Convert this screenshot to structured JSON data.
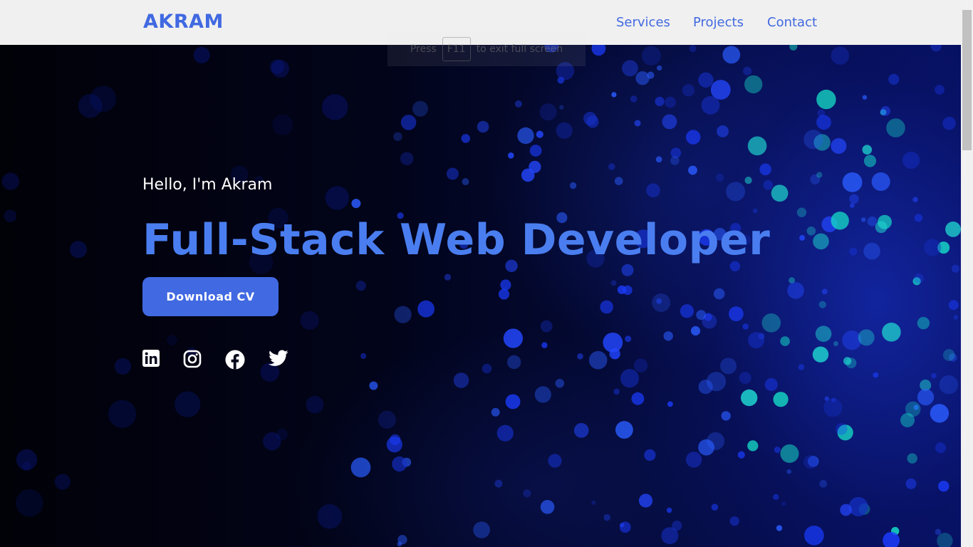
{
  "nav": {
    "logo": "AKRAM",
    "links": [
      {
        "label": "Services"
      },
      {
        "label": "Projects"
      },
      {
        "label": "Contact"
      }
    ]
  },
  "hero": {
    "greeting": "Hello, I'm Akram",
    "headline": "Full-Stack Web Developer",
    "button_label": "Download CV",
    "socials": [
      "linkedin-icon",
      "instagram-icon",
      "facebook-icon",
      "twitter-icon"
    ]
  },
  "fullscreen_hint": {
    "before": "Press",
    "key": "F11",
    "after": "to exit full screen"
  },
  "colors": {
    "accent": "#4169e1",
    "headline": "#4a7ef0",
    "navbar": "#f0f0f0",
    "hero_bg": "#000000"
  }
}
